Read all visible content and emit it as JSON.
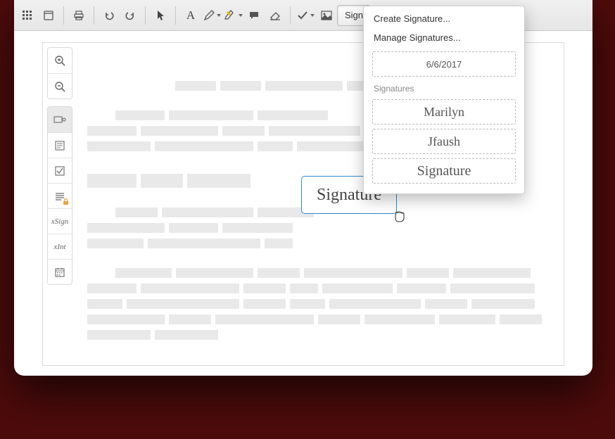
{
  "toolbar": {
    "sign_label": "Sign"
  },
  "dropdown": {
    "create": "Create Signature...",
    "manage": "Manage Signatures...",
    "date": "6/6/2017",
    "section_label": "Signatures",
    "sig1": "Marilyn",
    "sig2": "Jfaush",
    "sig3": "Signature"
  },
  "placed": {
    "signature_text": "Signature"
  },
  "sidebar": {
    "sign": "xSign",
    "init": "xInt"
  },
  "icons": {
    "grid": "grid-icon",
    "page": "page-icon",
    "print": "print-icon",
    "undo": "undo-icon",
    "redo": "redo-icon",
    "pointer": "pointer-icon",
    "text": "text-A-icon",
    "pencil": "pencil-icon",
    "highlighter": "highlighter-icon",
    "comment": "comment-icon",
    "eraser": "eraser-icon",
    "check": "check-icon",
    "image": "image-icon",
    "zoom_in": "zoom-in-icon",
    "zoom_out": "zoom-out-icon",
    "annotate": "annotate-icon",
    "form": "form-icon",
    "checkbox": "checkbox-icon",
    "redact": "redact-icon",
    "signature": "signature-icon",
    "initials": "initials-icon",
    "date": "calendar-icon"
  }
}
